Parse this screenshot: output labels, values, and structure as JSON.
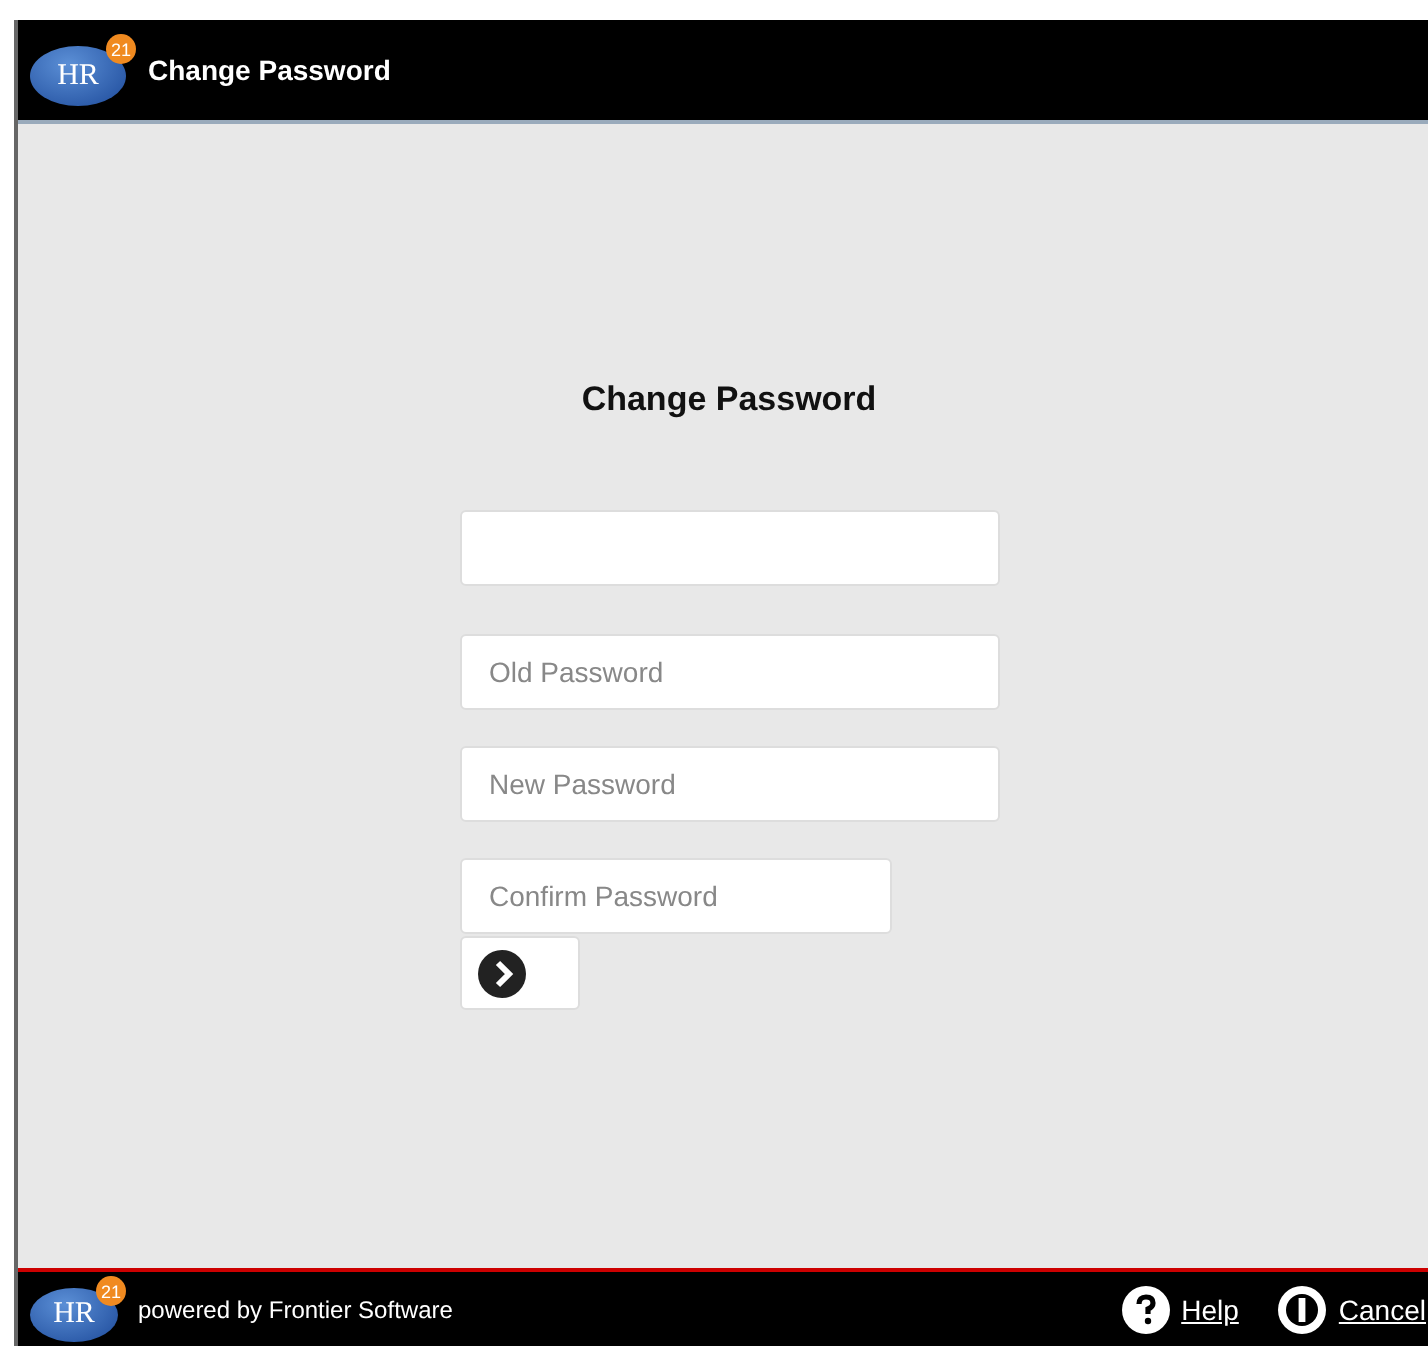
{
  "header": {
    "logo": {
      "text": "HR",
      "badge": "21"
    },
    "title": "Change Password"
  },
  "form": {
    "heading": "Change Password",
    "fields": [
      {
        "wide": true
      },
      {
        "placeholder": "Old Password",
        "wide": true
      },
      {
        "placeholder": "New Password",
        "wide": true
      },
      {
        "placeholder": "Confirm Password",
        "wide": false
      }
    ]
  },
  "footer": {
    "logo": {
      "text": "HR",
      "badge": "21"
    },
    "credit": "powered by Frontier Software",
    "links": [
      {
        "kind": "help",
        "label": "Help"
      },
      {
        "kind": "cancel",
        "label": "Cancel"
      }
    ]
  }
}
